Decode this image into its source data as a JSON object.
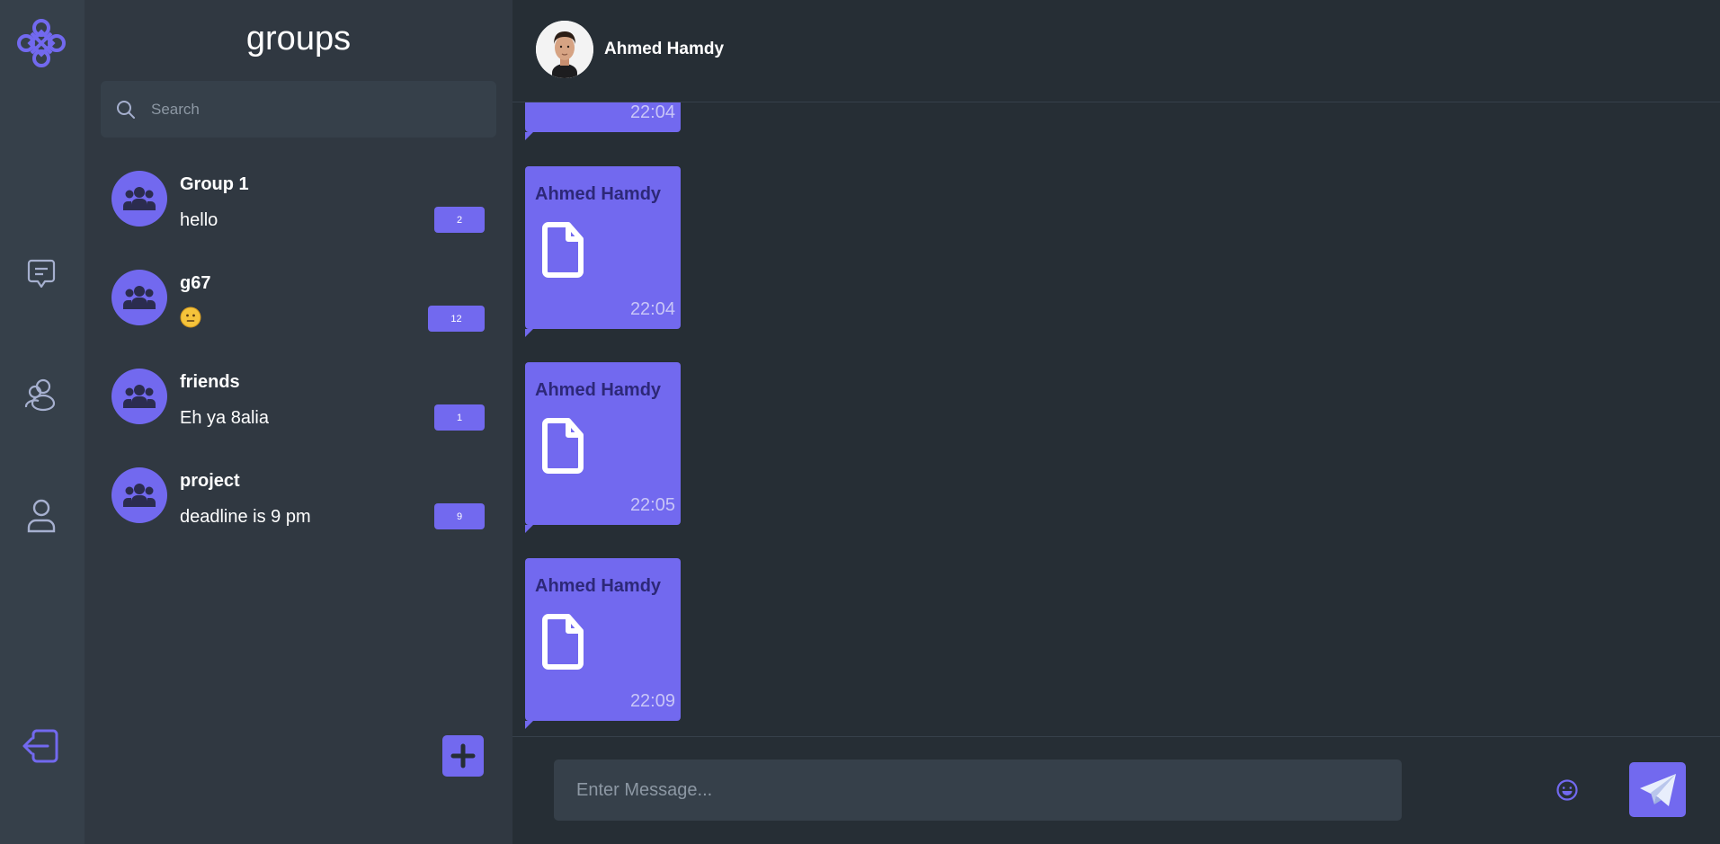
{
  "colors": {
    "accent": "#7269ef",
    "rail_bg": "#36404a",
    "panel_bg": "#303841",
    "chat_bg": "#262e35"
  },
  "rail": {
    "icons": [
      "logo-icon",
      "chat-icon",
      "groups-icon",
      "profile-icon",
      "logout-icon"
    ]
  },
  "groups_panel": {
    "title": "groups",
    "search": {
      "placeholder": "Search",
      "value": ""
    },
    "groups": [
      {
        "name": "Group 1",
        "last_message": "hello",
        "unread": "2"
      },
      {
        "name": "g67",
        "last_message_icon": "neutral-face-emoji",
        "unread": "12"
      },
      {
        "name": "friends",
        "last_message": "Eh ya 8alia",
        "unread": "1"
      },
      {
        "name": "project",
        "last_message": "deadline is 9 pm",
        "unread": "9"
      }
    ],
    "add_button_icon": "plus-icon"
  },
  "chat": {
    "header": {
      "name": "Ahmed Hamdy"
    },
    "messages": [
      {
        "sender": "",
        "attachment_icon": "",
        "time": "22:04"
      },
      {
        "sender": "Ahmed Hamdy",
        "attachment_icon": "file-icon",
        "time": "22:04"
      },
      {
        "sender": "Ahmed Hamdy",
        "attachment_icon": "file-icon",
        "time": "22:05"
      },
      {
        "sender": "Ahmed Hamdy",
        "attachment_icon": "file-icon",
        "time": "22:09"
      }
    ],
    "composer": {
      "placeholder": "Enter Message...",
      "value": "",
      "icons": [
        "emoji-icon",
        "attachment-icon",
        "send-icon"
      ]
    }
  }
}
